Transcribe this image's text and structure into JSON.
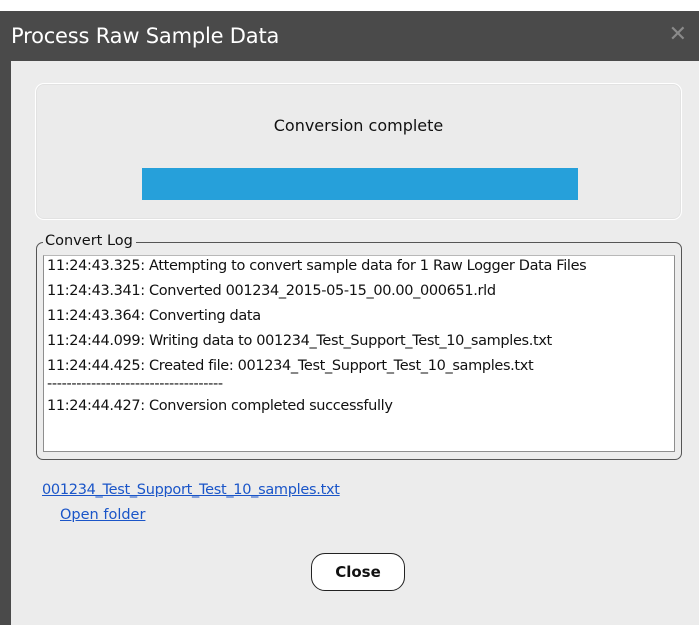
{
  "dialog": {
    "title": "Process Raw Sample Data",
    "close_glyph": "✕"
  },
  "status": {
    "text": "Conversion complete",
    "progress_percent": 100,
    "progress_color": "#26a0da"
  },
  "log": {
    "legend": "Convert Log",
    "lines": [
      "11:24:43.325: Attempting to convert sample data for 1 Raw Logger Data Files",
      "11:24:43.341: Converted 001234_2015-05-15_00.00_000651.rld",
      "11:24:43.364: Converting data",
      "11:24:44.099: Writing data to 001234_Test_Support_Test_10_samples.txt",
      "11:24:44.425: Created file: 001234_Test_Support_Test_10_samples.txt",
      "------------------------------------",
      "11:24:44.427: Conversion completed successfully"
    ]
  },
  "links": {
    "file": "001234_Test_Support_Test_10_samples.txt",
    "folder": "Open folder"
  },
  "buttons": {
    "close_label": "Close"
  },
  "icons": {
    "window_close": "close-icon"
  },
  "colors": {
    "titlebar": "#4a4a4a",
    "dialog_body": "#ececec",
    "link": "#1a55c8"
  }
}
